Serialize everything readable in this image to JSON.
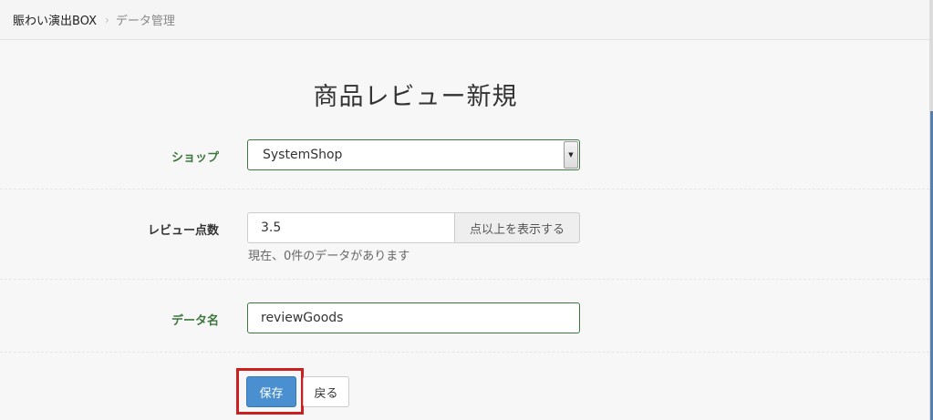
{
  "breadcrumb": {
    "home": "賑わい演出BOX",
    "separator": "›",
    "current": "データ管理"
  },
  "page": {
    "title": "商品レビュー新規"
  },
  "form": {
    "shop": {
      "label": "ショップ",
      "selected": "SystemShop"
    },
    "review_score": {
      "label": "レビュー点数",
      "value": "3.5",
      "addon": "点以上を表示する",
      "help": "現在、0件のデータがあります"
    },
    "data_name": {
      "label": "データ名",
      "value": "reviewGoods"
    },
    "actions": {
      "save_label": "保存",
      "back_label": "戻る"
    }
  },
  "colors": {
    "accent_green": "#3c763d",
    "primary_blue": "#4a90d0",
    "highlight_red": "#cc1f1f"
  },
  "icons": {
    "dropdown": "caret-down-icon",
    "separator": "chevron-right-icon"
  }
}
